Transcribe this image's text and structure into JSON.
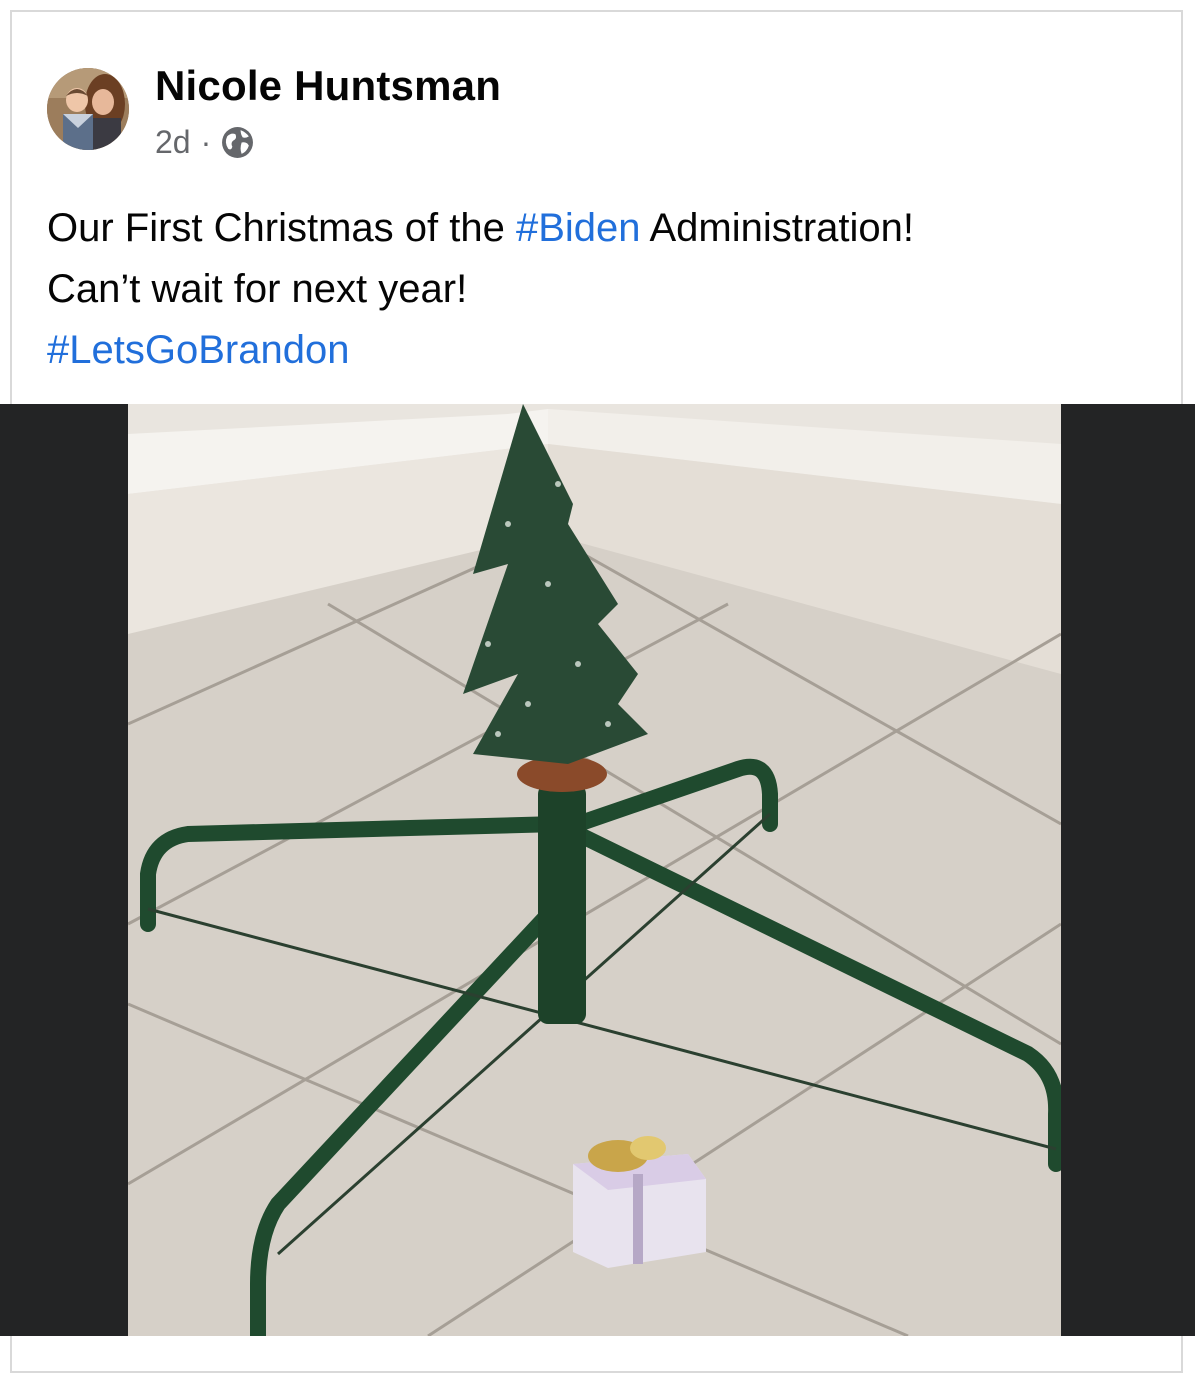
{
  "post": {
    "author_name": "Nicole Huntsman",
    "timestamp": "2d",
    "separator": "·",
    "privacy_icon": "globe-icon",
    "text": {
      "line1_before": "Our First Christmas of the ",
      "line1_hashtag": "#Biden",
      "line1_after": " Administration!",
      "line2": "Can’t wait for next year!",
      "line3_hashtag": "#LetsGoBrandon"
    },
    "colors": {
      "hashtag": "#216fdb",
      "meta_text": "#65676b",
      "media_background": "#232425"
    }
  }
}
